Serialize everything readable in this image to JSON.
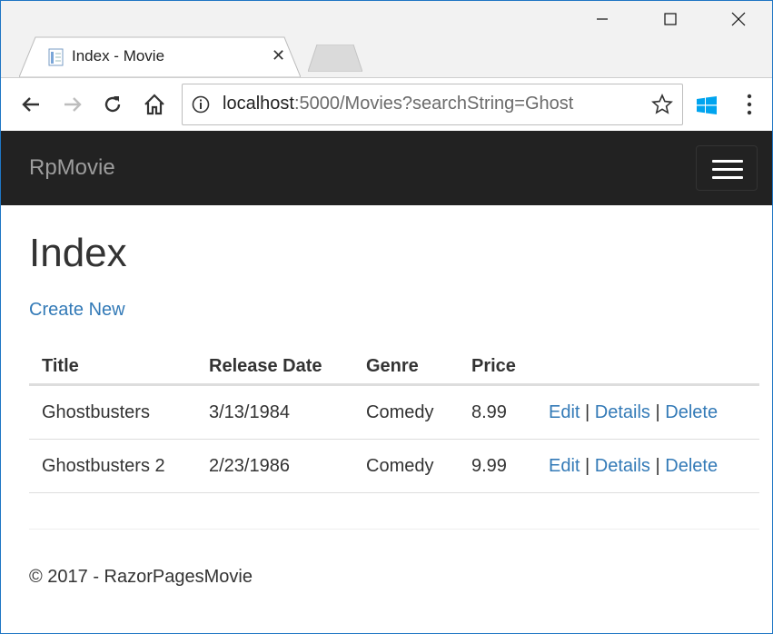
{
  "window": {
    "tab_title": "Index - Movie",
    "url_host": "localhost",
    "url_rest": ":5000/Movies?searchString=Ghost"
  },
  "page": {
    "brand": "RpMovie",
    "heading": "Index",
    "create_link": "Create New",
    "table": {
      "headers": [
        "Title",
        "Release Date",
        "Genre",
        "Price"
      ],
      "rows": [
        {
          "title": "Ghostbusters",
          "release_date": "3/13/1984",
          "genre": "Comedy",
          "price": "8.99"
        },
        {
          "title": "Ghostbusters 2",
          "release_date": "2/23/1986",
          "genre": "Comedy",
          "price": "9.99"
        }
      ],
      "actions": {
        "edit": "Edit",
        "details": "Details",
        "delete": "Delete",
        "separator": "|"
      }
    },
    "footer": "© 2017 - RazorPagesMovie"
  },
  "colors": {
    "navbar_bg": "#222222",
    "brand_text": "#9d9d9d",
    "link": "#337ab7",
    "window_border": "#1f76c4"
  }
}
